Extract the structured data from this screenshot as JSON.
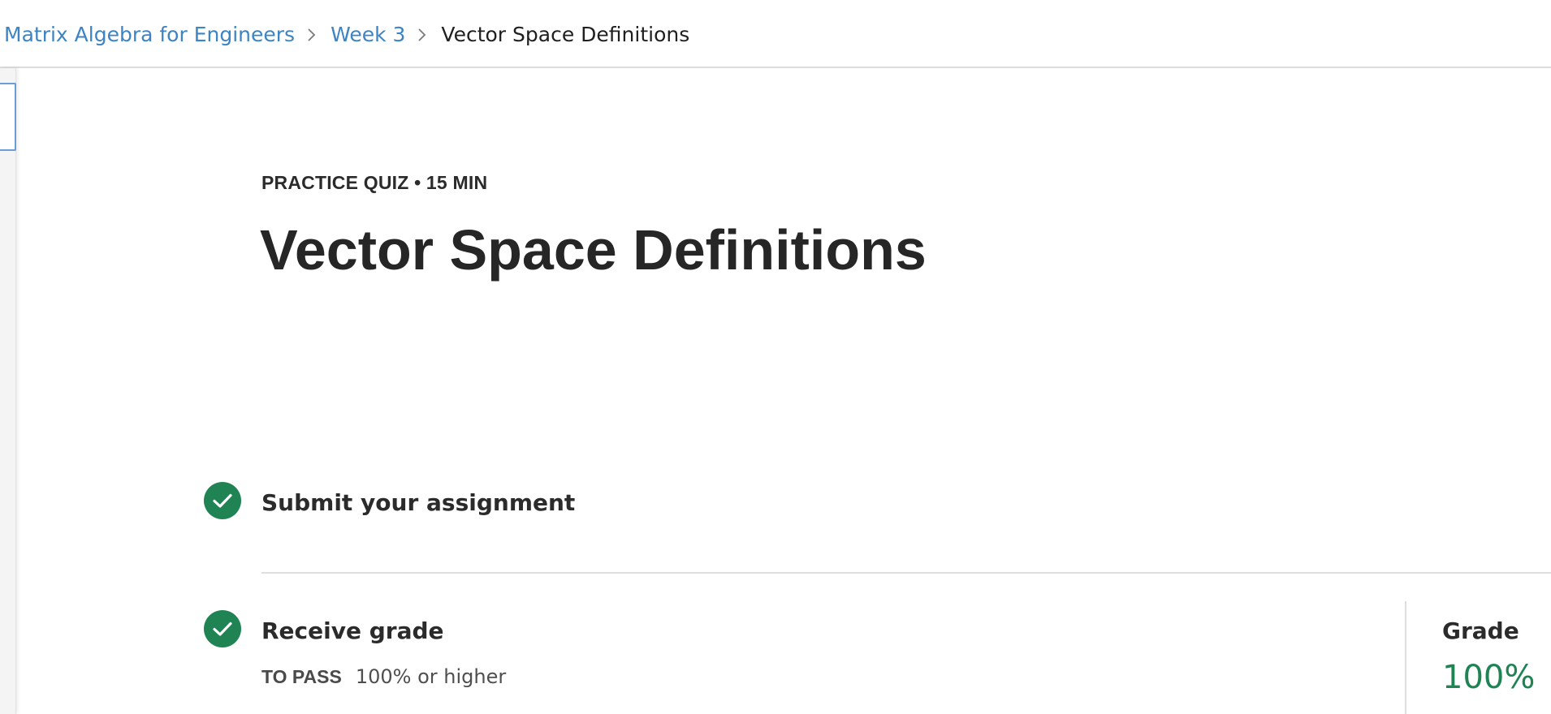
{
  "breadcrumb": {
    "course": "Matrix Algebra for Engineers",
    "week": "Week 3",
    "current": "Vector Space Definitions"
  },
  "header": {
    "kicker": "PRACTICE QUIZ • 15 MIN",
    "title": "Vector Space Definitions"
  },
  "steps": {
    "submit": {
      "label": "Submit your assignment",
      "icon": "check-circle-icon",
      "status": "complete"
    },
    "receive": {
      "label": "Receive grade",
      "icon": "check-circle-icon",
      "status": "complete",
      "pass_label": "TO PASS",
      "pass_value": "100% or higher"
    }
  },
  "grade": {
    "label": "Grade",
    "value": "100%"
  },
  "colors": {
    "link": "#3d84c4",
    "success": "#1f8354",
    "text": "#262626"
  }
}
